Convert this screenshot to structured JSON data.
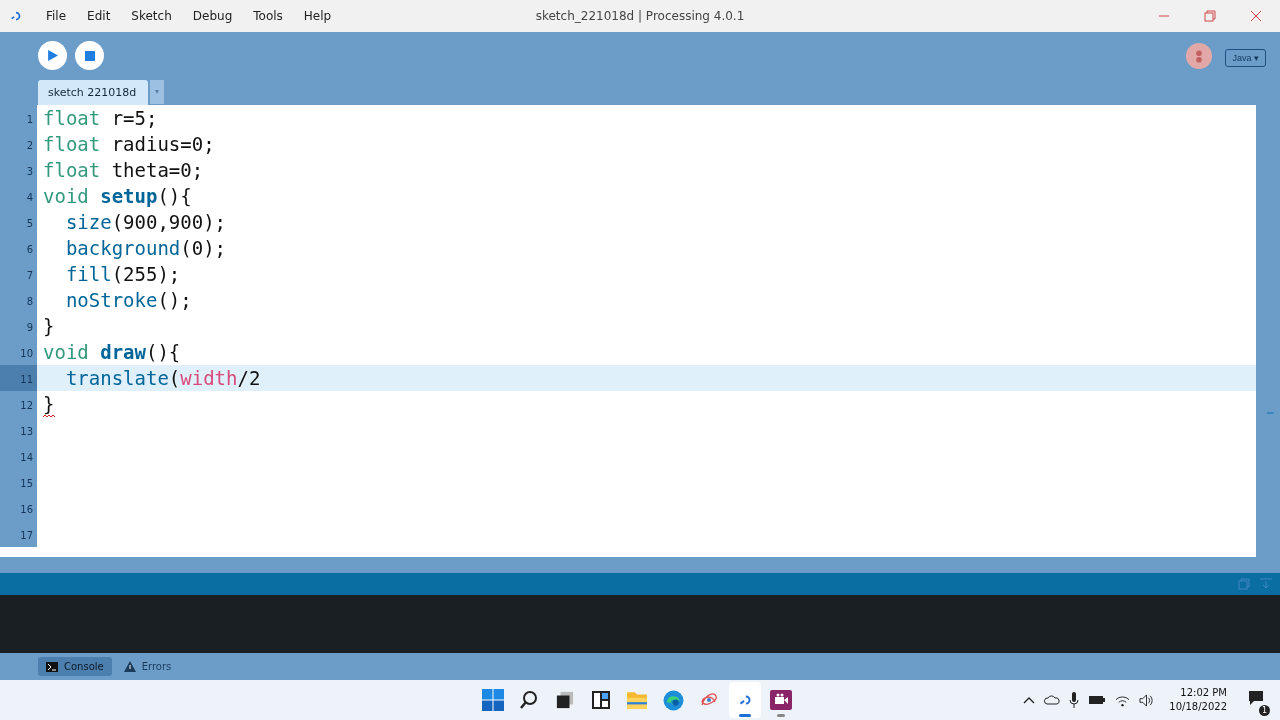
{
  "window": {
    "title": "sketch_221018d | Processing 4.0.1"
  },
  "menu": [
    "File",
    "Edit",
    "Sketch",
    "Debug",
    "Tools",
    "Help"
  ],
  "mode_button": {
    "label": "Java ▾"
  },
  "tabs": [
    {
      "label": "sketch 221018d",
      "selected": true
    }
  ],
  "editor": {
    "lines": [
      {
        "number": "1",
        "current": false,
        "tokens": [
          {
            "text": "float",
            "kind": "type"
          },
          {
            "text": " r=5;",
            "kind": "plain"
          }
        ]
      },
      {
        "number": "2",
        "current": false,
        "tokens": [
          {
            "text": "float",
            "kind": "type"
          },
          {
            "text": " radius=0;",
            "kind": "plain"
          }
        ]
      },
      {
        "number": "3",
        "current": false,
        "tokens": [
          {
            "text": "float",
            "kind": "type"
          },
          {
            "text": " theta=0;",
            "kind": "plain"
          }
        ]
      },
      {
        "number": "4",
        "current": false,
        "tokens": [
          {
            "text": "void",
            "kind": "type"
          },
          {
            "text": "setup",
            "kind": "method"
          },
          {
            "text": "(){",
            "kind": "plain"
          }
        ]
      },
      {
        "number": "5",
        "current": false,
        "tokens": [
          {
            "text": "  size",
            "kind": "builtin"
          },
          {
            "text": "(900,900);",
            "kind": "plain"
          }
        ]
      },
      {
        "number": "6",
        "current": false,
        "tokens": [
          {
            "text": "  background",
            "kind": "builtin"
          },
          {
            "text": "(0);",
            "kind": "plain"
          }
        ]
      },
      {
        "number": "7",
        "current": false,
        "tokens": [
          {
            "text": "  fill",
            "kind": "builtin"
          },
          {
            "text": "(255);",
            "kind": "plain"
          }
        ]
      },
      {
        "number": "8",
        "current": false,
        "tokens": [
          {
            "text": "  noStroke",
            "kind": "builtin"
          },
          {
            "text": "();",
            "kind": "plain"
          }
        ]
      },
      {
        "number": "9",
        "current": false,
        "tokens": [
          {
            "text": "}",
            "kind": "plain"
          }
        ]
      },
      {
        "number": "10",
        "current": false,
        "tokens": [
          {
            "text": "void",
            "kind": "type"
          },
          {
            "text": "draw",
            "kind": "method"
          },
          {
            "text": "(){",
            "kind": "plain"
          }
        ]
      },
      {
        "number": "11",
        "current": true,
        "tokens": [
          {
            "text": "  translate",
            "kind": "builtin"
          },
          {
            "text": "(",
            "kind": "plain"
          },
          {
            "text": "width",
            "kind": "variable"
          },
          {
            "text": "/2",
            "kind": "plain"
          }
        ]
      },
      {
        "number": "12",
        "current": false,
        "error": true,
        "tokens": [
          {
            "text": "}",
            "kind": "plain"
          }
        ]
      },
      {
        "number": "13",
        "current": false
      },
      {
        "number": "14",
        "current": false
      },
      {
        "number": "15",
        "current": false
      },
      {
        "number": "16",
        "current": false
      },
      {
        "number": "17",
        "current": false
      }
    ]
  },
  "console_tabs": [
    {
      "label": "Console",
      "kind": "console",
      "selected": true
    },
    {
      "label": "Errors",
      "kind": "errors",
      "selected": false
    }
  ],
  "taskbar": {
    "apps": [
      {
        "kind": "start",
        "running": false,
        "selected": false
      },
      {
        "kind": "search",
        "running": false,
        "selected": false
      },
      {
        "kind": "taskview",
        "running": false,
        "selected": false
      },
      {
        "kind": "widgets",
        "running": false,
        "selected": false
      },
      {
        "kind": "folder",
        "running": false,
        "selected": false
      },
      {
        "kind": "browser",
        "running": false,
        "selected": false
      },
      {
        "kind": "scribble",
        "running": false,
        "selected": false
      },
      {
        "kind": "processing",
        "running": true,
        "selected": true
      },
      {
        "kind": "recorder",
        "running": true,
        "selected": false
      }
    ],
    "time": "12:02 PM",
    "date": "10/18/2022",
    "notifications": "1"
  }
}
